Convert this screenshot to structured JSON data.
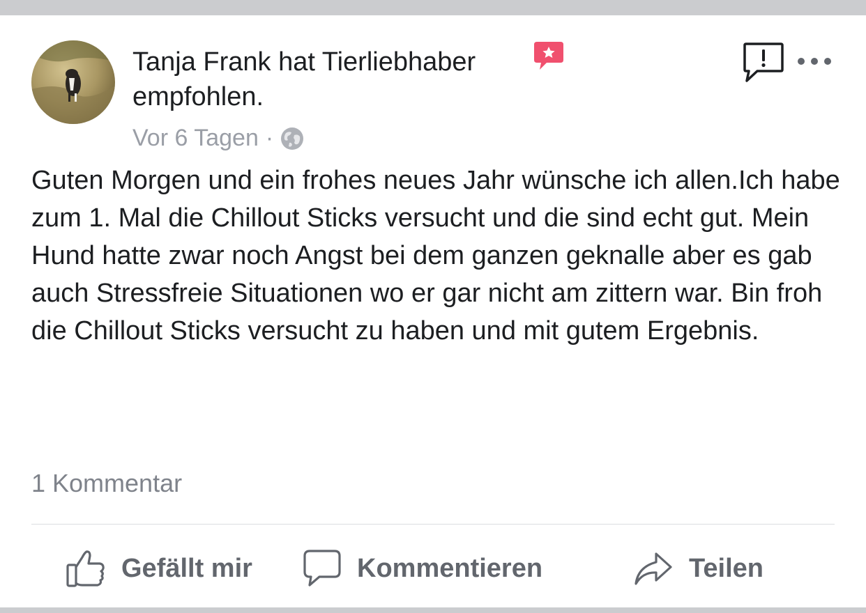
{
  "post": {
    "author_line": "Tanja Frank hat Tierliebhaber empfohlen.",
    "timestamp": "Vor 6 Tagen",
    "separator": "·",
    "body": "Guten Morgen und ein frohes neues Jahr wünsche ich allen.Ich habe zum 1. Mal die Chillout Sticks versucht und die sind echt gut. Mein Hund hatte zwar noch Angst bei dem ganzen geknalle aber es gab auch Stressfreie Situationen wo er gar nicht am zittern war. Bin froh die Chillout Sticks versucht zu haben und mit gutem Ergebnis.",
    "comment_count": "1 Kommentar"
  },
  "actions": {
    "like_label": "Gefällt mir",
    "comment_label": "Kommentieren",
    "share_label": "Teilen"
  },
  "icons": {
    "recommendation": "recommendation-badge-icon",
    "privacy": "globe-icon",
    "report": "report-icon",
    "more": "more-dots-icon",
    "like": "thumbs-up-icon",
    "comment": "comment-bubble-icon",
    "share": "share-arrow-icon"
  },
  "colors": {
    "text": "#1c1e21",
    "muted": "#9a9ea6",
    "action_gray": "#62666d",
    "recommend_red": "#f0506e",
    "frame": "#cbcccf"
  }
}
